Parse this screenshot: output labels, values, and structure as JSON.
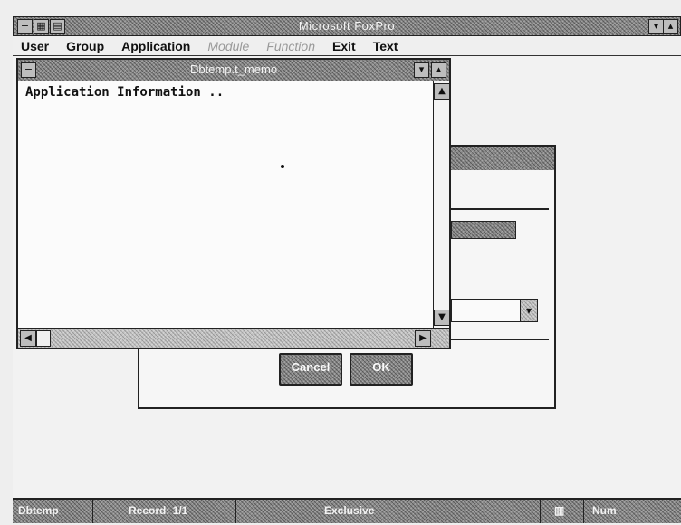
{
  "window": {
    "title": "Microsoft FoxPro"
  },
  "menubar": {
    "items": [
      {
        "label": "User",
        "enabled": true
      },
      {
        "label": "Group",
        "enabled": true
      },
      {
        "label": "Application",
        "enabled": true
      },
      {
        "label": "Module",
        "enabled": false
      },
      {
        "label": "Function",
        "enabled": false
      },
      {
        "label": "Exit",
        "enabled": true
      },
      {
        "label": "Text",
        "enabled": true
      }
    ]
  },
  "memo_window": {
    "title": "Dbtemp.t_memo",
    "content": "Application Information .."
  },
  "dialog": {
    "cancel_label": "Cancel",
    "ok_label": "OK"
  },
  "statusbar": {
    "table": "Dbtemp",
    "record": "Record: 1/1",
    "mode": "Exclusive",
    "num": "Num"
  },
  "icons": {
    "system_menu": "system-menu-icon",
    "maximize": "maximize-icon",
    "scroll_up": "scroll-up-arrow-icon",
    "scroll_down": "scroll-down-arrow-icon",
    "scroll_left": "scroll-left-arrow-icon",
    "scroll_right": "scroll-right-arrow-icon",
    "dropdown": "dropdown-arrow-icon"
  }
}
